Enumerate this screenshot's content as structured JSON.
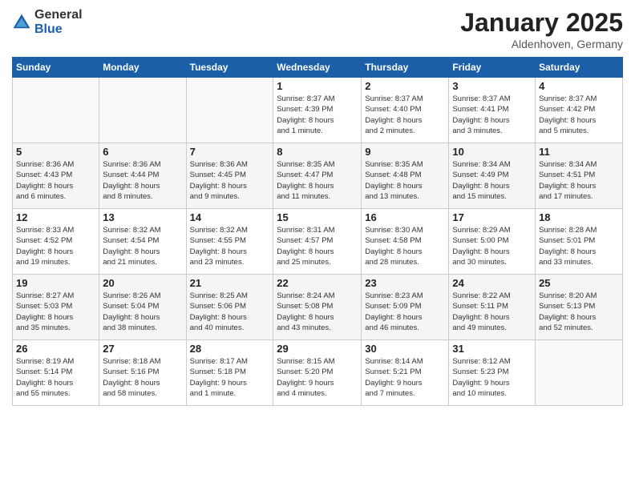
{
  "header": {
    "logo": {
      "general": "General",
      "blue": "Blue"
    },
    "title": "January 2025",
    "location": "Aldenhoven, Germany"
  },
  "calendar": {
    "days_of_week": [
      "Sunday",
      "Monday",
      "Tuesday",
      "Wednesday",
      "Thursday",
      "Friday",
      "Saturday"
    ],
    "weeks": [
      [
        {
          "day": "",
          "info": ""
        },
        {
          "day": "",
          "info": ""
        },
        {
          "day": "",
          "info": ""
        },
        {
          "day": "1",
          "info": "Sunrise: 8:37 AM\nSunset: 4:39 PM\nDaylight: 8 hours\nand 1 minute."
        },
        {
          "day": "2",
          "info": "Sunrise: 8:37 AM\nSunset: 4:40 PM\nDaylight: 8 hours\nand 2 minutes."
        },
        {
          "day": "3",
          "info": "Sunrise: 8:37 AM\nSunset: 4:41 PM\nDaylight: 8 hours\nand 3 minutes."
        },
        {
          "day": "4",
          "info": "Sunrise: 8:37 AM\nSunset: 4:42 PM\nDaylight: 8 hours\nand 5 minutes."
        }
      ],
      [
        {
          "day": "5",
          "info": "Sunrise: 8:36 AM\nSunset: 4:43 PM\nDaylight: 8 hours\nand 6 minutes."
        },
        {
          "day": "6",
          "info": "Sunrise: 8:36 AM\nSunset: 4:44 PM\nDaylight: 8 hours\nand 8 minutes."
        },
        {
          "day": "7",
          "info": "Sunrise: 8:36 AM\nSunset: 4:45 PM\nDaylight: 8 hours\nand 9 minutes."
        },
        {
          "day": "8",
          "info": "Sunrise: 8:35 AM\nSunset: 4:47 PM\nDaylight: 8 hours\nand 11 minutes."
        },
        {
          "day": "9",
          "info": "Sunrise: 8:35 AM\nSunset: 4:48 PM\nDaylight: 8 hours\nand 13 minutes."
        },
        {
          "day": "10",
          "info": "Sunrise: 8:34 AM\nSunset: 4:49 PM\nDaylight: 8 hours\nand 15 minutes."
        },
        {
          "day": "11",
          "info": "Sunrise: 8:34 AM\nSunset: 4:51 PM\nDaylight: 8 hours\nand 17 minutes."
        }
      ],
      [
        {
          "day": "12",
          "info": "Sunrise: 8:33 AM\nSunset: 4:52 PM\nDaylight: 8 hours\nand 19 minutes."
        },
        {
          "day": "13",
          "info": "Sunrise: 8:32 AM\nSunset: 4:54 PM\nDaylight: 8 hours\nand 21 minutes."
        },
        {
          "day": "14",
          "info": "Sunrise: 8:32 AM\nSunset: 4:55 PM\nDaylight: 8 hours\nand 23 minutes."
        },
        {
          "day": "15",
          "info": "Sunrise: 8:31 AM\nSunset: 4:57 PM\nDaylight: 8 hours\nand 25 minutes."
        },
        {
          "day": "16",
          "info": "Sunrise: 8:30 AM\nSunset: 4:58 PM\nDaylight: 8 hours\nand 28 minutes."
        },
        {
          "day": "17",
          "info": "Sunrise: 8:29 AM\nSunset: 5:00 PM\nDaylight: 8 hours\nand 30 minutes."
        },
        {
          "day": "18",
          "info": "Sunrise: 8:28 AM\nSunset: 5:01 PM\nDaylight: 8 hours\nand 33 minutes."
        }
      ],
      [
        {
          "day": "19",
          "info": "Sunrise: 8:27 AM\nSunset: 5:03 PM\nDaylight: 8 hours\nand 35 minutes."
        },
        {
          "day": "20",
          "info": "Sunrise: 8:26 AM\nSunset: 5:04 PM\nDaylight: 8 hours\nand 38 minutes."
        },
        {
          "day": "21",
          "info": "Sunrise: 8:25 AM\nSunset: 5:06 PM\nDaylight: 8 hours\nand 40 minutes."
        },
        {
          "day": "22",
          "info": "Sunrise: 8:24 AM\nSunset: 5:08 PM\nDaylight: 8 hours\nand 43 minutes."
        },
        {
          "day": "23",
          "info": "Sunrise: 8:23 AM\nSunset: 5:09 PM\nDaylight: 8 hours\nand 46 minutes."
        },
        {
          "day": "24",
          "info": "Sunrise: 8:22 AM\nSunset: 5:11 PM\nDaylight: 8 hours\nand 49 minutes."
        },
        {
          "day": "25",
          "info": "Sunrise: 8:20 AM\nSunset: 5:13 PM\nDaylight: 8 hours\nand 52 minutes."
        }
      ],
      [
        {
          "day": "26",
          "info": "Sunrise: 8:19 AM\nSunset: 5:14 PM\nDaylight: 8 hours\nand 55 minutes."
        },
        {
          "day": "27",
          "info": "Sunrise: 8:18 AM\nSunset: 5:16 PM\nDaylight: 8 hours\nand 58 minutes."
        },
        {
          "day": "28",
          "info": "Sunrise: 8:17 AM\nSunset: 5:18 PM\nDaylight: 9 hours\nand 1 minute."
        },
        {
          "day": "29",
          "info": "Sunrise: 8:15 AM\nSunset: 5:20 PM\nDaylight: 9 hours\nand 4 minutes."
        },
        {
          "day": "30",
          "info": "Sunrise: 8:14 AM\nSunset: 5:21 PM\nDaylight: 9 hours\nand 7 minutes."
        },
        {
          "day": "31",
          "info": "Sunrise: 8:12 AM\nSunset: 5:23 PM\nDaylight: 9 hours\nand 10 minutes."
        },
        {
          "day": "",
          "info": ""
        }
      ]
    ]
  }
}
